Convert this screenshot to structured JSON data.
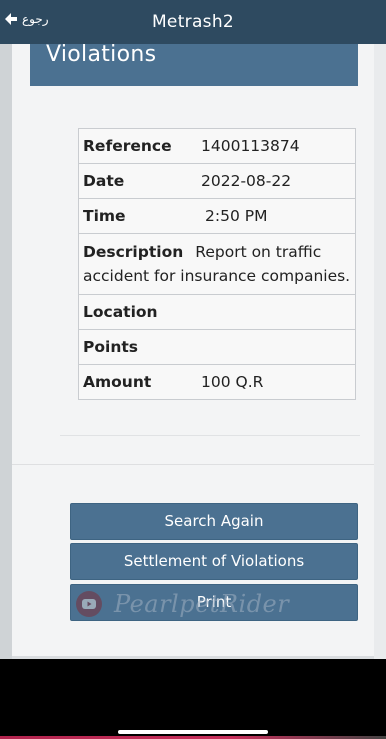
{
  "header": {
    "back_label": "رجوع",
    "title": "Metrash2"
  },
  "section": {
    "title": "Violations"
  },
  "details": {
    "reference": {
      "label": "Reference",
      "value": "1400113874"
    },
    "date": {
      "label": "Date",
      "value": "2022-08-22"
    },
    "time": {
      "label": "Time",
      "value": "2:50 PM"
    },
    "description": {
      "label": "Description",
      "value": "Report on traffic accident for insurance companies."
    },
    "location": {
      "label": "Location",
      "value": ""
    },
    "points": {
      "label": "Points",
      "value": ""
    },
    "amount": {
      "label": "Amount",
      "value": "100 Q.R"
    }
  },
  "buttons": {
    "search_again": "Search Again",
    "settlement": "Settlement of Violations",
    "print": "Print"
  },
  "watermark": {
    "text": "PearlpetRider",
    "icon": "youtube-icon"
  },
  "colors": {
    "topbar": "#2e4a60",
    "accent": "#4b7191"
  }
}
